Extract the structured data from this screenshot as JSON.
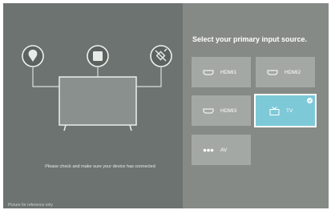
{
  "title": "Select your primary input source.",
  "inputs": [
    {
      "label": "HDMI1",
      "icon": "hdmi-icon"
    },
    {
      "label": "HDMI2",
      "icon": "hdmi-icon"
    },
    {
      "label": "HDMI3",
      "icon": "hdmi-icon"
    },
    {
      "label": "TV",
      "icon": "tv-icon",
      "selected": true
    },
    {
      "label": "AV",
      "icon": "av-icon"
    }
  ],
  "message": "Please check and make sure your device has connected",
  "footnote": "Picture for reference only",
  "colors": {
    "accent": "#7ec9d8",
    "left_bg": "#6c7370",
    "right_bg": "#858a87",
    "tile": "#a4a8a5"
  }
}
